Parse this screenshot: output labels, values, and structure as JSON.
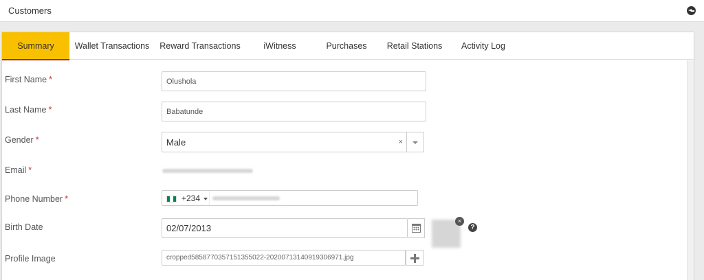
{
  "header": {
    "title": "Customers"
  },
  "tabs": [
    {
      "label": "Summary",
      "active": true
    },
    {
      "label": "Wallet Transactions"
    },
    {
      "label": "Reward Transactions"
    },
    {
      "label": "iWitness"
    },
    {
      "label": "Purchases"
    },
    {
      "label": "Retail Stations"
    },
    {
      "label": "Activity Log"
    }
  ],
  "form": {
    "required_mark": "*",
    "first_name": {
      "label": "First Name",
      "value": "Olushola"
    },
    "last_name": {
      "label": "Last Name",
      "value": "Babatunde"
    },
    "gender": {
      "label": "Gender",
      "value": "Male",
      "clear": "×"
    },
    "email": {
      "label": "Email"
    },
    "phone": {
      "label": "Phone Number",
      "country_code": "+234"
    },
    "birth_date": {
      "label": "Birth Date",
      "value": "02/07/2013"
    },
    "profile_image": {
      "label": "Profile Image",
      "filename": "cropped5858770357151355022-20200713140919306971.jpg",
      "remove": "×",
      "help": "?"
    }
  },
  "colors": {
    "active_tab": "#f9c000",
    "active_tab_underline": "#a42b1e",
    "required": "#c9302c",
    "flag_green": "#008751"
  },
  "icons": [
    "back-icon",
    "clear-icon",
    "chevron-down-icon",
    "caret-down-icon",
    "calendar-icon",
    "plus-icon",
    "close-icon",
    "help-icon",
    "nigeria-flag-icon"
  ]
}
